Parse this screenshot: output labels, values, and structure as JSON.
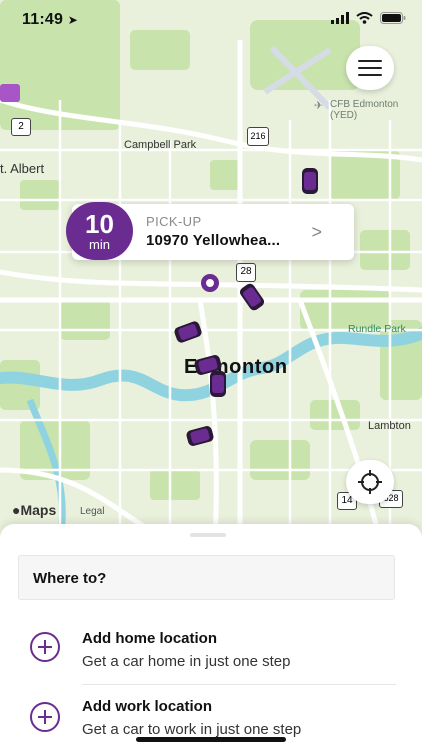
{
  "status_bar": {
    "time": "11:49",
    "icons": [
      "location-arrow-icon",
      "signal-icon",
      "wifi-icon",
      "battery-icon"
    ]
  },
  "map": {
    "labels": {
      "st_albert": "t. Albert",
      "campbell_park": "Campbell Park",
      "cfb_edmonton": "CFB Edmonton",
      "cfb_code": "(YED)",
      "city": "Edmonton",
      "rundle_park": "Rundle Park",
      "lambton": "Lambton"
    },
    "shields": [
      "2",
      "216",
      "28",
      "14",
      "628"
    ],
    "attribution": "Maps",
    "legal": "Legal",
    "colors": {
      "land": "#e9f1dc",
      "park": "#c9e3ad",
      "water": "#8fd3e0",
      "road": "#ffffff",
      "accent": "#6b2c91"
    }
  },
  "pickup": {
    "eta_value": "10",
    "eta_unit": "min",
    "label": "PICK-UP",
    "address": "10970 Yellowhea..."
  },
  "sheet": {
    "search_placeholder": "Where to?",
    "home": {
      "title": "Add home location",
      "subtitle": "Get a car home in just one step"
    },
    "work": {
      "title": "Add work location",
      "subtitle": "Get a car to work in just one step"
    }
  }
}
